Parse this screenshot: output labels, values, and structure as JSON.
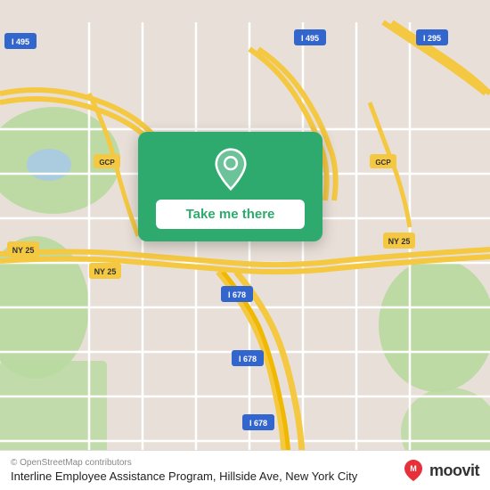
{
  "map": {
    "background_color": "#e8e0d8"
  },
  "card": {
    "button_label": "Take me there",
    "pin_icon": "location-pin",
    "background_color": "#2eaa6e"
  },
  "bottom_bar": {
    "copyright": "© OpenStreetMap contributors",
    "location_name": "Interline Employee Assistance Program, Hillside Ave, New York City",
    "logo_text": "moovit",
    "logo_icon": "moovit-icon"
  },
  "road_labels": {
    "i495_nw": "I 495",
    "i495_ne": "I 495",
    "i295": "I 295",
    "ny25_w": "NY 25",
    "ny25_center": "NY 25",
    "ny25_e": "NY 25",
    "gcp_w": "GCP",
    "gcp_e": "GCP",
    "i678_center": "I 678",
    "i678_s1": "I 678",
    "i678_s2": "I 678"
  }
}
